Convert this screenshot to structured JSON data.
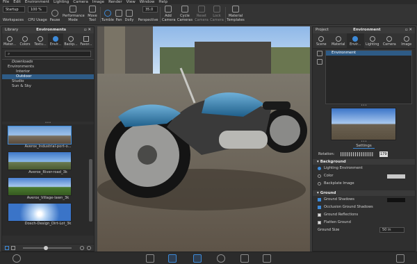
{
  "menubar": [
    "File",
    "Edit",
    "Environment",
    "Lighting",
    "Camera",
    "Image",
    "Render",
    "View",
    "Window",
    "Help"
  ],
  "toolbar": {
    "workspace_select": "Startup",
    "zoom_select": "100 %",
    "workspaces": "Workspaces",
    "cpu_usage": "CPU Usage",
    "pause": "Pause",
    "performance_mode": "Performance Mode",
    "move_tool": "Move Tool",
    "tumble": "Tumble",
    "pan": "Pan",
    "dolly": "Dolly",
    "fov_value": "35.0",
    "perspective": "Perspective",
    "add_camera": "Add Camera",
    "cycle_cameras": "Cycle Cameras",
    "reset_camera": "Reset Camera",
    "lock_camera": "Lock Camera",
    "material_templates": "Material Templates"
  },
  "library": {
    "title": "Library",
    "center_title": "Environments",
    "tabs": [
      "Mater...",
      "Colors",
      "Textu...",
      "Envir...",
      "Backp...",
      "Favor..."
    ],
    "active_tab": 3,
    "tree": {
      "root": "Downloads",
      "group": "Environments",
      "items": [
        "Interior",
        "Outdoor"
      ],
      "selected": "Outdoor",
      "studio": "Studio",
      "sun_sky": "Sun & Sky"
    },
    "thumbnails": [
      "Averox_Industrial-port-o...",
      "Averox_River-road_3k",
      "Averox_Village-lawn_3k",
      "Dosch-Design_Dirt-Lot_3k"
    ]
  },
  "project": {
    "title": "Project",
    "center_title": "Environment",
    "tabs": [
      "Scene",
      "Material",
      "Envir...",
      "Lighting",
      "Camera",
      "Image"
    ],
    "active_tab": 2,
    "list_item": "Environment",
    "settings_label": "Settings",
    "rotation_label": "Rotation:",
    "rotation_value": "179",
    "sections": {
      "background": "Background",
      "ground": "Ground"
    },
    "background_options": [
      "Lighting Environment",
      "Color",
      "Backplate Image"
    ],
    "background_selected": 0,
    "ground_options": [
      {
        "label": "Ground Shadows",
        "checked": true
      },
      {
        "label": "Occlusion Ground Shadows",
        "checked": true
      },
      {
        "label": "Ground Reflections",
        "checked": false
      },
      {
        "label": "Flatten Ground",
        "checked": false
      }
    ],
    "ground_size_label": "Ground Size",
    "ground_size_value": "50 in"
  },
  "colors": {
    "accent": "#3d8ad8",
    "panel": "#2f2f2f",
    "selection": "#2e5b86"
  }
}
